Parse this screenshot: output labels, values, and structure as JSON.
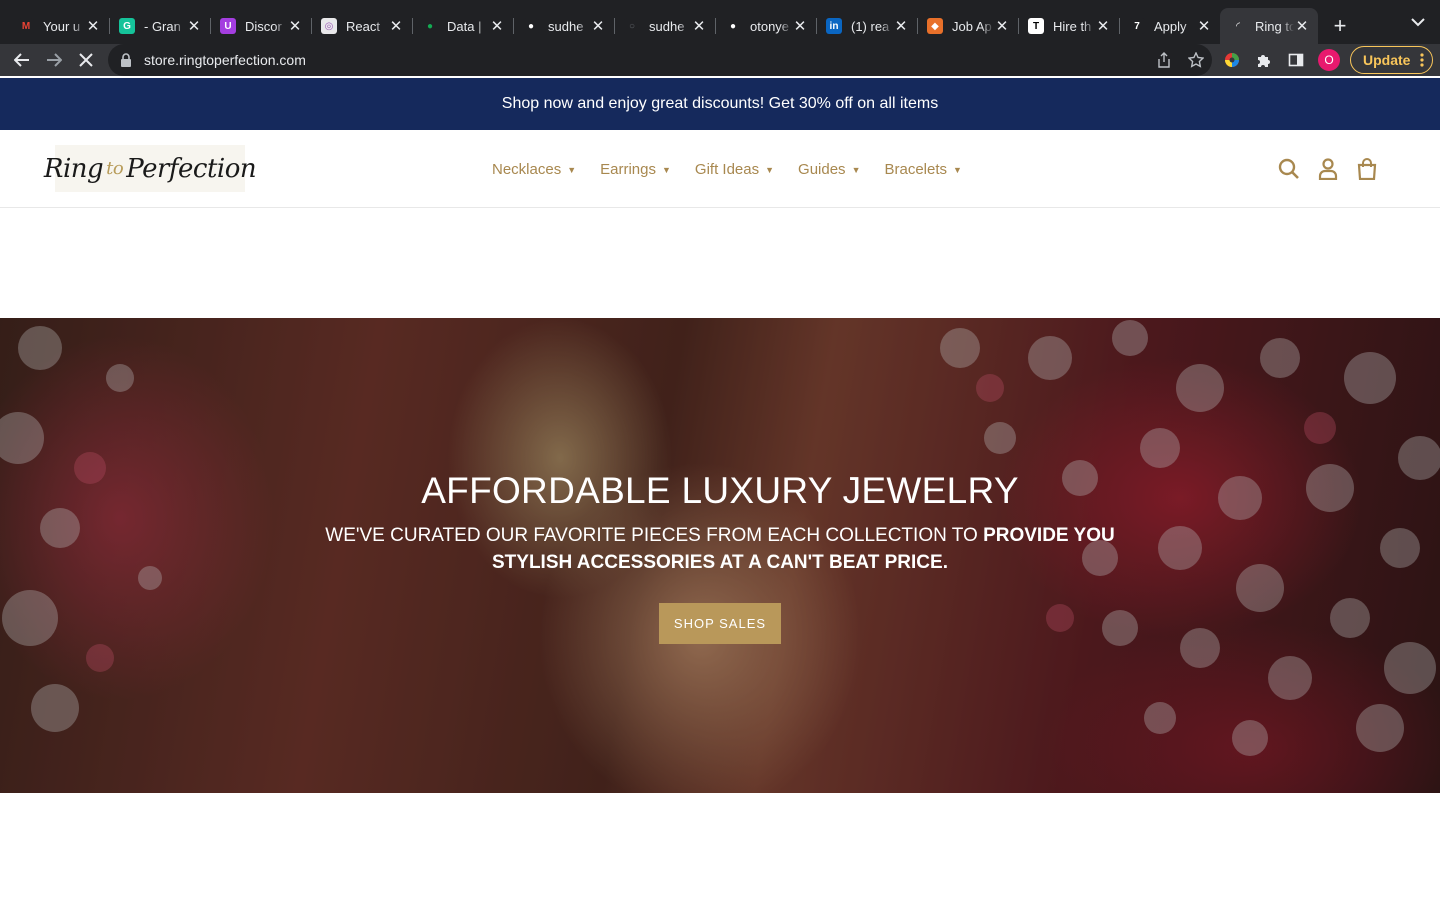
{
  "browser": {
    "tabs": [
      {
        "title": "Your u",
        "icon": "gmail-icon",
        "color": "#202124",
        "glyph": "M",
        "glyph_color": "#ea4335"
      },
      {
        "title": "- Gran",
        "icon": "grammarly-icon",
        "color": "#15c39a",
        "glyph": "G"
      },
      {
        "title": "Discor",
        "icon": "discord-icon",
        "color": "#a43ee0",
        "glyph": "U"
      },
      {
        "title": "React",
        "icon": "react-icon",
        "color": "#e8e8ea",
        "glyph": "◎",
        "glyph_color": "#9b59b6"
      },
      {
        "title": "Data |",
        "icon": "leaf-icon",
        "color": "#202124",
        "glyph": "●",
        "glyph_color": "#13aa52"
      },
      {
        "title": "sudhe",
        "icon": "github-icon",
        "color": "#202124",
        "glyph": "●"
      },
      {
        "title": "sudhe",
        "icon": "github-icon",
        "color": "#202124",
        "glyph": "○",
        "glyph_color": "#5f6368"
      },
      {
        "title": "otonye",
        "icon": "github-icon",
        "color": "#202124",
        "glyph": "●"
      },
      {
        "title": "(1) rea",
        "icon": "linkedin-icon",
        "color": "#0a66c2",
        "glyph": "in"
      },
      {
        "title": "Job Ap",
        "icon": "job-app-icon",
        "color": "#e8702a",
        "glyph": "◆"
      },
      {
        "title": "Hire th",
        "icon": "hire-icon",
        "color": "#ffffff",
        "glyph": "T",
        "glyph_color": "#000000"
      },
      {
        "title": "Apply",
        "icon": "apply-icon",
        "color": "#202124",
        "glyph": "7"
      },
      {
        "title": "Ring to",
        "icon": "loading-spinner-icon",
        "color": "#35363a",
        "glyph": "◜",
        "active": true
      }
    ],
    "new_tab": "+",
    "url": "store.ringtoperfection.com",
    "profile_initial": "O",
    "update_label": "Update"
  },
  "announcement": "Shop now and enjoy great discounts! Get 30% off on all items",
  "header": {
    "logo_part1": "Ring",
    "logo_part2": "to",
    "logo_part3": "Perfection",
    "nav": [
      "Necklaces",
      "Earrings",
      "Gift Ideas",
      "Guides",
      "Bracelets"
    ]
  },
  "hero": {
    "title": "AFFORDABLE LUXURY JEWELRY",
    "subtitle_regular": "WE'VE CURATED OUR FAVORITE PIECES FROM EACH COLLECTION TO ",
    "subtitle_bold": "PROVIDE YOU STYLISH ACCESSORIES AT A CAN'T BEAT PRICE.",
    "button": "SHOP SALES"
  },
  "colors": {
    "announce_bg": "#15295c",
    "accent_gold": "#b9985a",
    "nav_gold": "#a8884f"
  }
}
